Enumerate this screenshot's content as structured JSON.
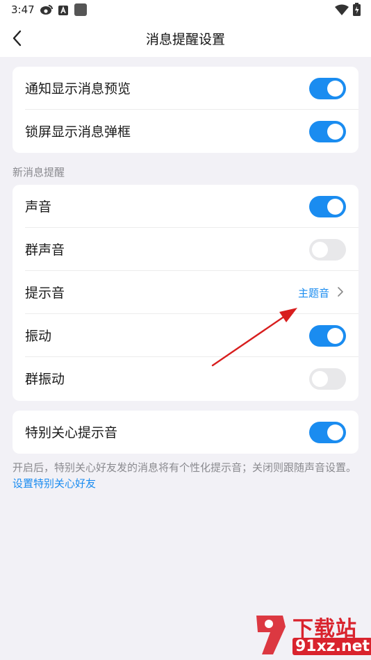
{
  "status_bar": {
    "time": "3:47",
    "left_icons": [
      "weibo-icon",
      "a-box-icon",
      "square-icon"
    ],
    "right_icons": [
      "wifi-icon",
      "battery-icon"
    ]
  },
  "header": {
    "title": "消息提醒设置",
    "back_icon": "chevron-left-icon"
  },
  "group1": {
    "rows": [
      {
        "label": "通知显示消息预览",
        "toggle": true
      },
      {
        "label": "锁屏显示消息弹框",
        "toggle": true
      }
    ]
  },
  "section_new_messages": {
    "label": "新消息提醒",
    "rows": [
      {
        "label": "声音",
        "toggle": true
      },
      {
        "label": "群声音",
        "toggle": false
      },
      {
        "label": "提示音",
        "value": "主题音"
      },
      {
        "label": "振动",
        "toggle": true
      },
      {
        "label": "群振动",
        "toggle": false
      }
    ]
  },
  "group3": {
    "rows": [
      {
        "label": "特别关心提示音",
        "toggle": true
      }
    ]
  },
  "footnote": {
    "text": "开启后，特别关心好友发的消息将有个性化提示音；关闭则跟随声音设置。",
    "link": "设置特别关心好友"
  },
  "watermark": {
    "top": "下载站",
    "bottom": "91xz.net"
  },
  "colors": {
    "accent": "#1a8cf0",
    "toggle_off": "#e8e8ea",
    "background": "#f2f1f6",
    "annotation_arrow": "#d81e1e"
  }
}
